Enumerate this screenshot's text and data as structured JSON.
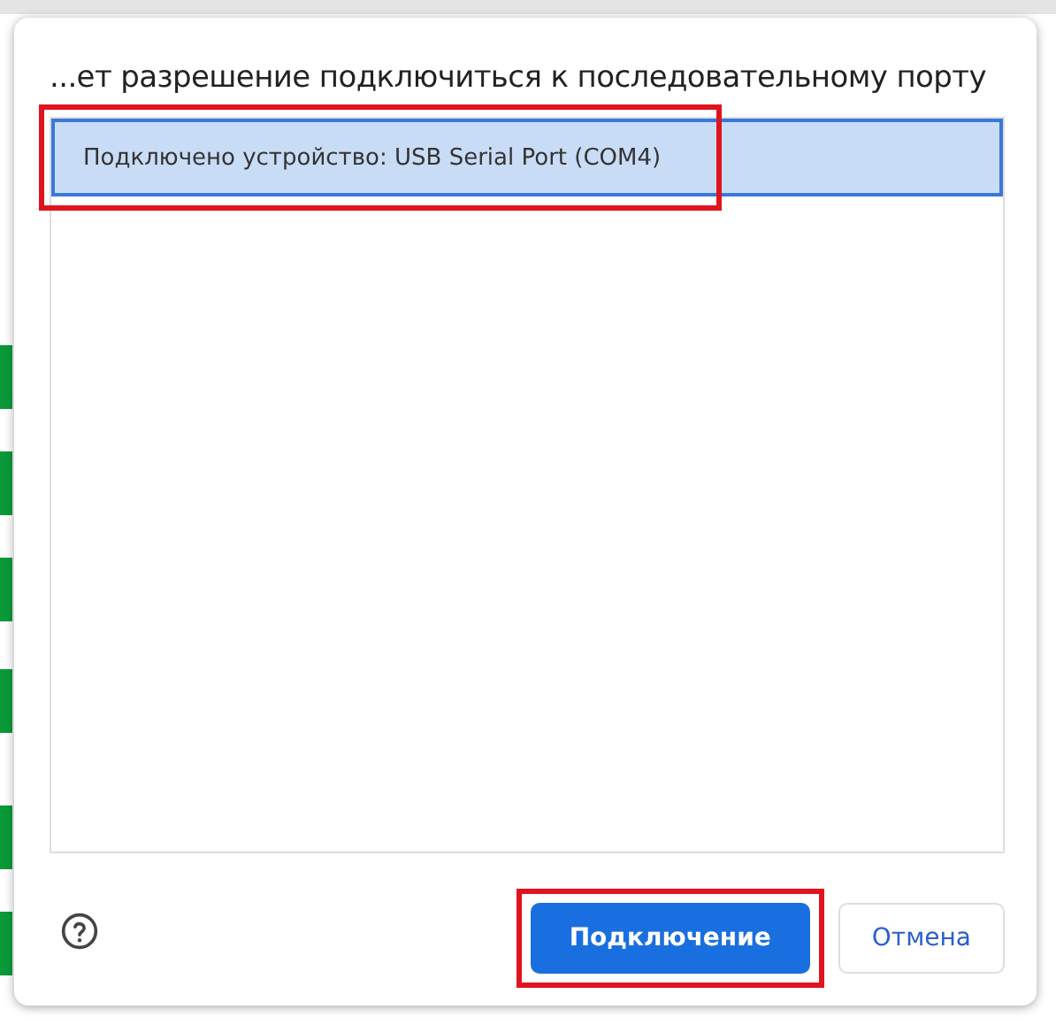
{
  "dialog": {
    "title": "...ет разрешение подключиться к последовательному порту",
    "devices": [
      {
        "label": "Подключено устройство: USB Serial Port (COM4)",
        "selected": true,
        "highlighted": true
      }
    ],
    "buttons": [
      {
        "label": "Подключение",
        "kind": "primary",
        "highlighted": true
      },
      {
        "label": "Отмена",
        "kind": "secondary",
        "highlighted": false
      }
    ]
  }
}
